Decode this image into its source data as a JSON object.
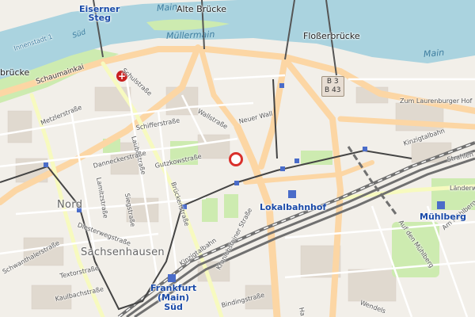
{
  "map": {
    "labels": {
      "eiserner_steg": "Eiserner\nSteg",
      "alte_bruecke": "Alte Brücke",
      "main_top": "Main",
      "muellermain": "Müllermain",
      "flosserbruecke": "Floßerbrücke",
      "main_right": "Main",
      "innenstadt": "Innenstadt 1",
      "sued_top": "Süd",
      "bruecke_left": "brücke",
      "schaumainkai": "Schaumainkai",
      "schulstrasse": "Schulstraße",
      "metzlerstrasse": "Metzlerstraße",
      "wallstrasse": "Wallstraße",
      "neuer_wall": "Neuer Wall",
      "schifferstrasse": "Schifferstraße",
      "laubestrasse": "Laubestraße",
      "danneckerstrasse": "Danneckerstraße",
      "gutzkowstrasse": "Gutzkowstraße",
      "lamitzstrasse": "Lamitzstraße",
      "brueckenstrasse": "Brückenstraße",
      "siegstrasse": "Siegstraße",
      "nord": "Nord",
      "diesterwegstrasse": "Diesterwegstraße",
      "sachsenhausen": "Sachsenhausen",
      "schwanthalerstrasse": "Schwanthalerstraße",
      "textorstrasse": "Textorstraße",
      "kaulbachstrasse": "Kaulbachstraße",
      "lokalbahnhof": "Lokalbahnhof",
      "frankfurt_sued": "Frankfurt\n(Main)\nSüd",
      "kranichsteiner": "Kranichsteiner Straße",
      "bindingstrasse": "Bindingstraße",
      "zum_lauren": "Zum Laurenburger Hof",
      "kinzigtalbahn": "Kinzigtalbahn",
      "strahlen": "Strahlen",
      "laender": "Länderw",
      "muehlberg": "Mühlberg",
      "am_muehlberg": "Am Mühlberg",
      "auf_den_muehlberg": "Auf den Mühlberg",
      "kinzigtalbahn_lower": "Kinzigtalbahn",
      "wendel": "Wendels",
      "ha": "Ha"
    },
    "shields": {
      "b3": "B 3",
      "b43": "B 43"
    },
    "colors": {
      "land": "#f2efe9",
      "water": "#aad3df",
      "major_road": "#fcd6a4",
      "secondary_road": "#f7fabf",
      "green": "#cdebb0",
      "rail": "#707070",
      "tram": "#444444",
      "marker": "#d9302b"
    },
    "icons": {
      "hospital": "hospital-icon",
      "location": "location-marker-icon"
    }
  }
}
